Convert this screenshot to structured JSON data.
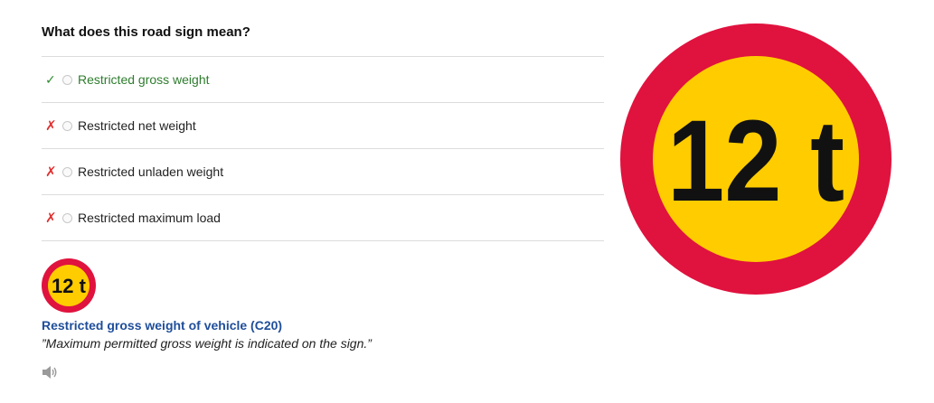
{
  "question": "What does this road sign mean?",
  "options": [
    {
      "label": "Restricted gross weight",
      "status": "correct",
      "mark_icon": "check-icon"
    },
    {
      "label": "Restricted net weight",
      "status": "wrong",
      "mark_icon": "cross-icon"
    },
    {
      "label": "Restricted unladen weight",
      "status": "wrong",
      "mark_icon": "cross-icon"
    },
    {
      "label": "Restricted maximum load",
      "status": "wrong",
      "mark_icon": "cross-icon"
    }
  ],
  "marks": {
    "correct": "✓",
    "wrong": "✗"
  },
  "sign": {
    "text": "12 t",
    "ring_color": "#e0123e",
    "fill_color": "#ffcc00",
    "text_color": "#111111"
  },
  "explanation": {
    "title": "Restricted gross weight of vehicle (C20)",
    "description": "”Maximum permitted gross weight is indicated on the sign.”",
    "audio_icon": "speaker-icon"
  },
  "colors": {
    "correct": "#2e7d2e",
    "wrong": "#e03030",
    "link": "#1f4e9a"
  }
}
